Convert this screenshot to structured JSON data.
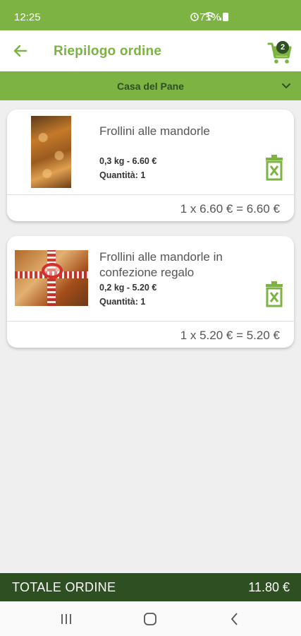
{
  "status": {
    "time": "12:25",
    "battery": "71%"
  },
  "header": {
    "title": "Riepilogo ordine",
    "cart_count": "2"
  },
  "shop": {
    "name": "Casa del Pane"
  },
  "items": [
    {
      "name": "Frollini alle mandorle",
      "weight_price": "0,3 kg - 6.60 €",
      "quantity": "Quantità: 1",
      "line_total": "1 x 6.60 € = 6.60 €"
    },
    {
      "name": "Frollini alle mandorle in confezione regalo",
      "weight_price": "0,2 kg - 5.20 €",
      "quantity": "Quantità: 1",
      "line_total": "1 x 5.20 € = 5.20 €"
    }
  ],
  "total": {
    "label": "TOTALE ORDINE",
    "value": "11.80 €"
  },
  "colors": {
    "primary": "#7cb342",
    "dark": "#2e4f22"
  },
  "icons": [
    "back-arrow-icon",
    "cart-icon",
    "chevron-down-icon",
    "trash-icon",
    "recent-apps-icon",
    "home-icon",
    "back-icon"
  ]
}
